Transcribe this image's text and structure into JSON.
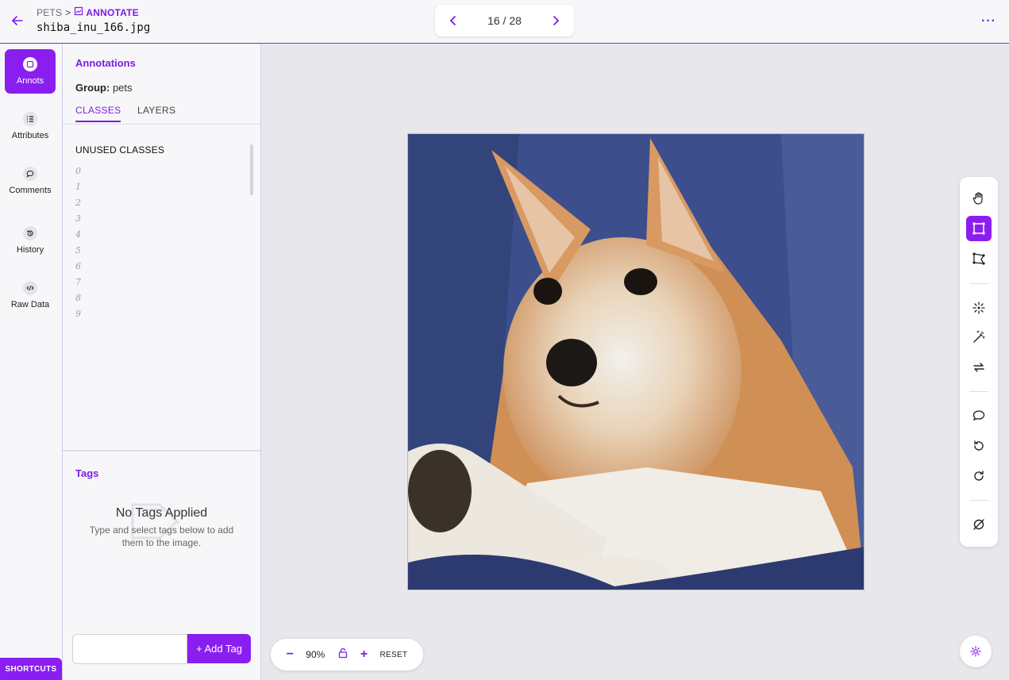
{
  "header": {
    "breadcrumb_root": "PETS",
    "breadcrumb_sep": ">",
    "breadcrumb_current": "ANNOTATE",
    "filename": "shiba_inu_166.jpg",
    "pager_count": "16 / 28",
    "more": "···"
  },
  "rail": {
    "items": [
      {
        "label": "Annots",
        "icon": "annotation-icon"
      },
      {
        "label": "Attributes",
        "icon": "list-icon"
      },
      {
        "label": "Comments",
        "icon": "comment-icon"
      },
      {
        "label": "History",
        "icon": "history-icon"
      },
      {
        "label": "Raw Data",
        "icon": "code-icon"
      }
    ],
    "shortcuts": "SHORTCUTS"
  },
  "panel": {
    "title": "Annotations",
    "group_label": "Group:",
    "group_value": "pets",
    "tabs": [
      "CLASSES",
      "LAYERS"
    ],
    "unused_title": "UNUSED CLASSES",
    "classes": [
      "0",
      "1",
      "2",
      "3",
      "4",
      "5",
      "6",
      "7",
      "8",
      "9"
    ],
    "tags_title": "Tags",
    "no_tags": "No Tags Applied",
    "no_tags_hint": "Type and select tags below to add them to the image.",
    "tag_input_placeholder": "",
    "add_tag": "+ Add Tag"
  },
  "zoom": {
    "minus": "−",
    "value": "90%",
    "plus": "+",
    "reset": "RESET"
  },
  "colors": {
    "accent": "#8a1ef0",
    "accent_text": "#7c1ce6"
  }
}
